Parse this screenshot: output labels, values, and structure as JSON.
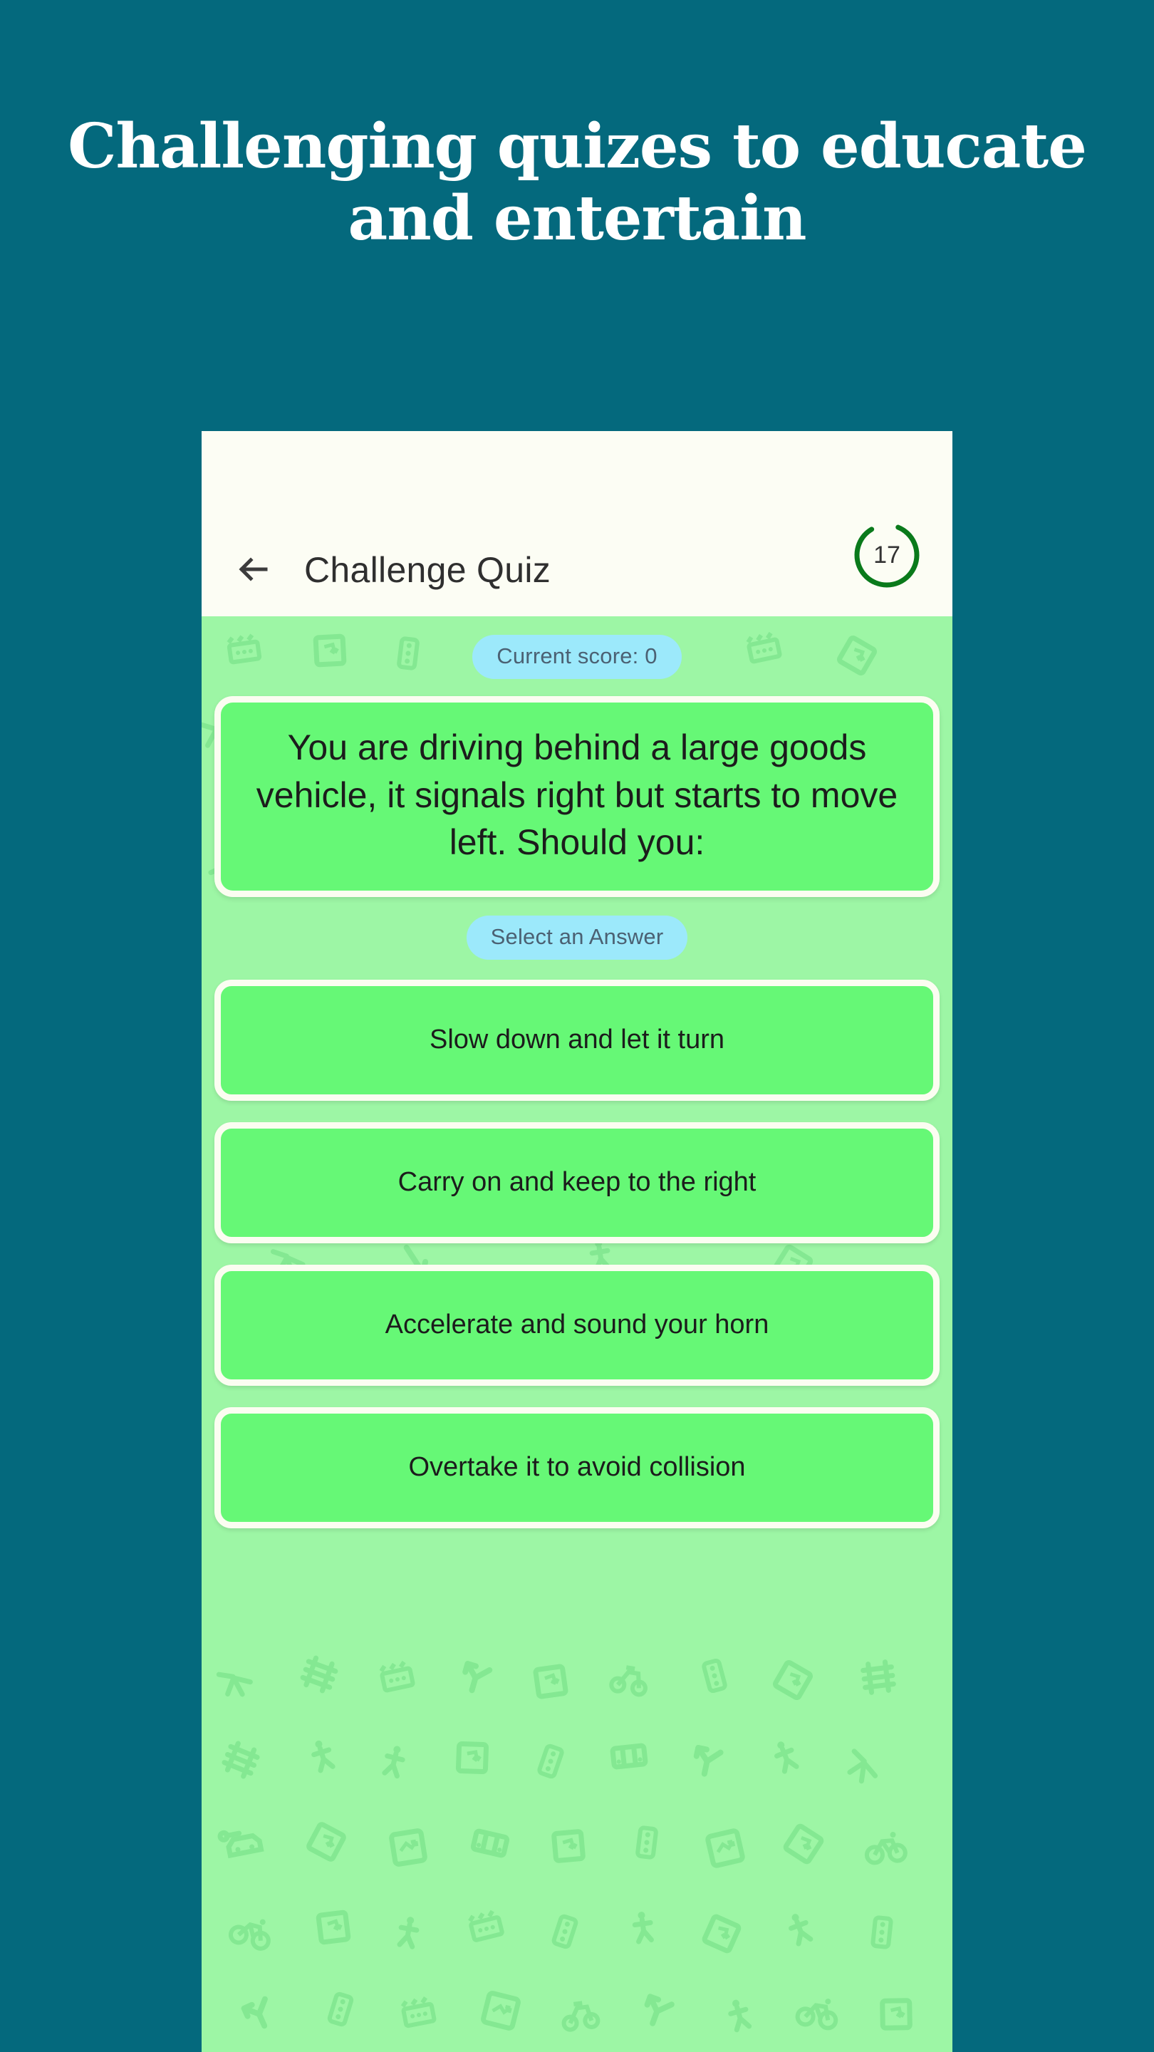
{
  "promo": {
    "headline": "Challenging quizes to educate and entertain",
    "background_color": "#04697d",
    "text_color": "#ffffff"
  },
  "app": {
    "app_bar": {
      "back_icon": "arrow-left-icon",
      "title": "Challenge Quiz",
      "background_color": "#fcfdf4",
      "timer": {
        "icon": "circular-timer-icon",
        "value": "17",
        "ring_color": "#0a7a1b",
        "progress_percent": 85
      }
    },
    "quiz": {
      "background_color": "#9df6a5",
      "pattern_icon_color": "#6fdc83",
      "score_badge": {
        "label": "Current score: 0",
        "background_color": "#9ce9fb",
        "text_color": "#4b6173"
      },
      "question": {
        "text": "You are driving behind a large goods vehicle, it signals right but starts to move left. Should you:",
        "background_color": "#66f876",
        "border_color": "#fbfdf1"
      },
      "select_badge": {
        "label": "Select an Answer",
        "background_color": "#9ce9fb",
        "text_color": "#4b6173"
      },
      "options": [
        {
          "label": "Slow down and let it turn"
        },
        {
          "label": "Carry on and keep to the right"
        },
        {
          "label": "Accelerate and sound your horn"
        },
        {
          "label": "Overtake it to avoid collision"
        }
      ]
    }
  }
}
